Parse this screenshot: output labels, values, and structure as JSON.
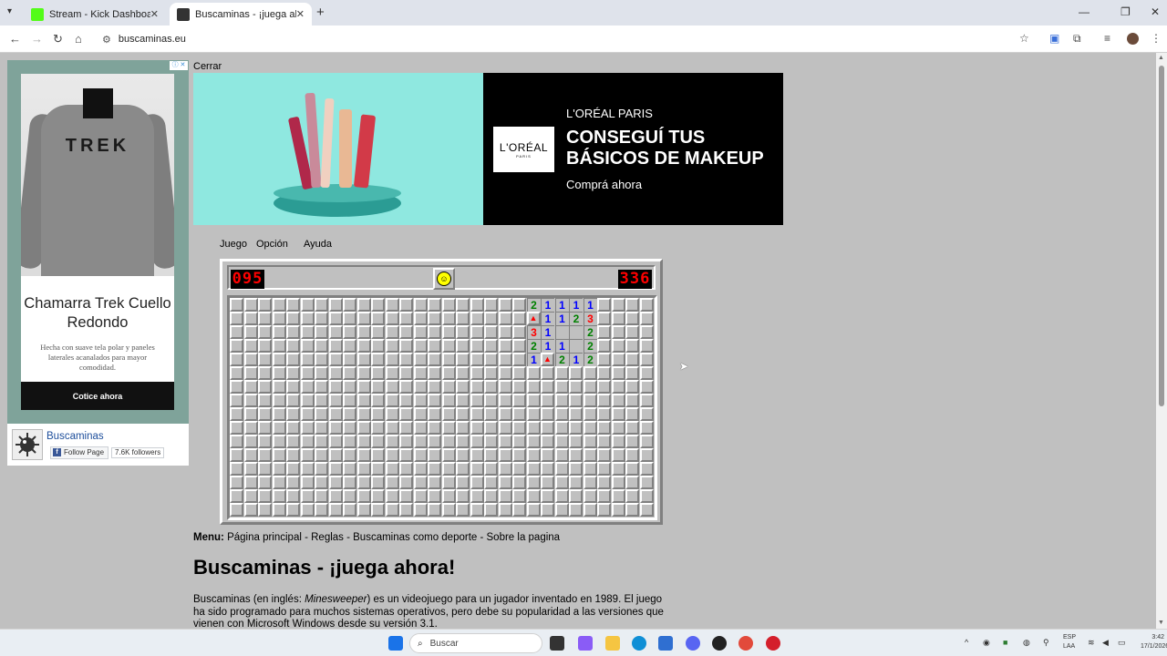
{
  "browser": {
    "tabs": [
      {
        "label": "Stream - Kick Dashboard",
        "favicon_color": "#53fc18",
        "active": false
      },
      {
        "label": "Buscaminas - ¡juega ahora!",
        "favicon_color": "#333333",
        "active": true
      }
    ],
    "url": "buscaminas.eu"
  },
  "ad_left": {
    "brand_label": "TREK",
    "title": "Chamarra Trek Cuello Redondo",
    "description": "Hecha con suave tela polar y paneles laterales acanalados para mayor comodidad.",
    "cta": "Cotice ahora"
  },
  "facebook": {
    "page_name": "Buscaminas",
    "follow_label": "Follow Page",
    "followers": "7.6K followers"
  },
  "close_label": "Cerrar",
  "banner": {
    "logo": "L'ORÉAL",
    "logo_sub": "PARIS",
    "brand": "L'ORÉAL PARIS",
    "headline": "CONSEGUÍ TUS BÁSICOS DE MAKEUP",
    "cta": "Comprá ahora"
  },
  "game_menu": [
    "Juego",
    "Opción",
    "Ayuda"
  ],
  "game": {
    "mines_counter": "095",
    "timer": "336",
    "smiley": "☺",
    "cols": 30,
    "rows": 16,
    "revealed": [
      [
        0,
        21,
        "2"
      ],
      [
        0,
        22,
        "1"
      ],
      [
        0,
        23,
        "1"
      ],
      [
        0,
        24,
        "1"
      ],
      [
        0,
        25,
        "1"
      ],
      [
        1,
        21,
        "F"
      ],
      [
        1,
        22,
        "1"
      ],
      [
        1,
        23,
        "1"
      ],
      [
        1,
        24,
        "2"
      ],
      [
        1,
        25,
        "3"
      ],
      [
        2,
        21,
        "3"
      ],
      [
        2,
        22,
        "1"
      ],
      [
        2,
        23,
        ""
      ],
      [
        2,
        24,
        ""
      ],
      [
        2,
        25,
        "2"
      ],
      [
        3,
        21,
        "2"
      ],
      [
        3,
        22,
        "1"
      ],
      [
        3,
        23,
        "1"
      ],
      [
        3,
        24,
        ""
      ],
      [
        3,
        25,
        "2"
      ],
      [
        4,
        21,
        "1"
      ],
      [
        4,
        22,
        "F"
      ],
      [
        4,
        23,
        "2"
      ],
      [
        4,
        24,
        "1"
      ],
      [
        4,
        25,
        "2"
      ]
    ],
    "flags_in_row0": [
      24
    ]
  },
  "number_colors": {
    "1": "#0000ff",
    "2": "#008000",
    "3": "#ff0000"
  },
  "content": {
    "menu_label": "Menu:",
    "menu_links": "Página principal - Reglas - Buscaminas como deporte - Sobre la pagina",
    "heading": "Buscaminas - ¡juega ahora!",
    "intro_a": "Buscaminas (en inglés: ",
    "intro_em": "Minesweeper",
    "intro_b": ") es un videojuego para un jugador inventado en 1989. El juego ha sido programado para muchos sistemas operativos, pero debe su popularidad a las versiones que vienen con Microsoft Windows desde su versión 3.1."
  },
  "taskbar": {
    "search_placeholder": "Buscar",
    "lang": "ESP",
    "lang_sub": "LAA",
    "time": "3:42",
    "date": "17/1/2026"
  }
}
